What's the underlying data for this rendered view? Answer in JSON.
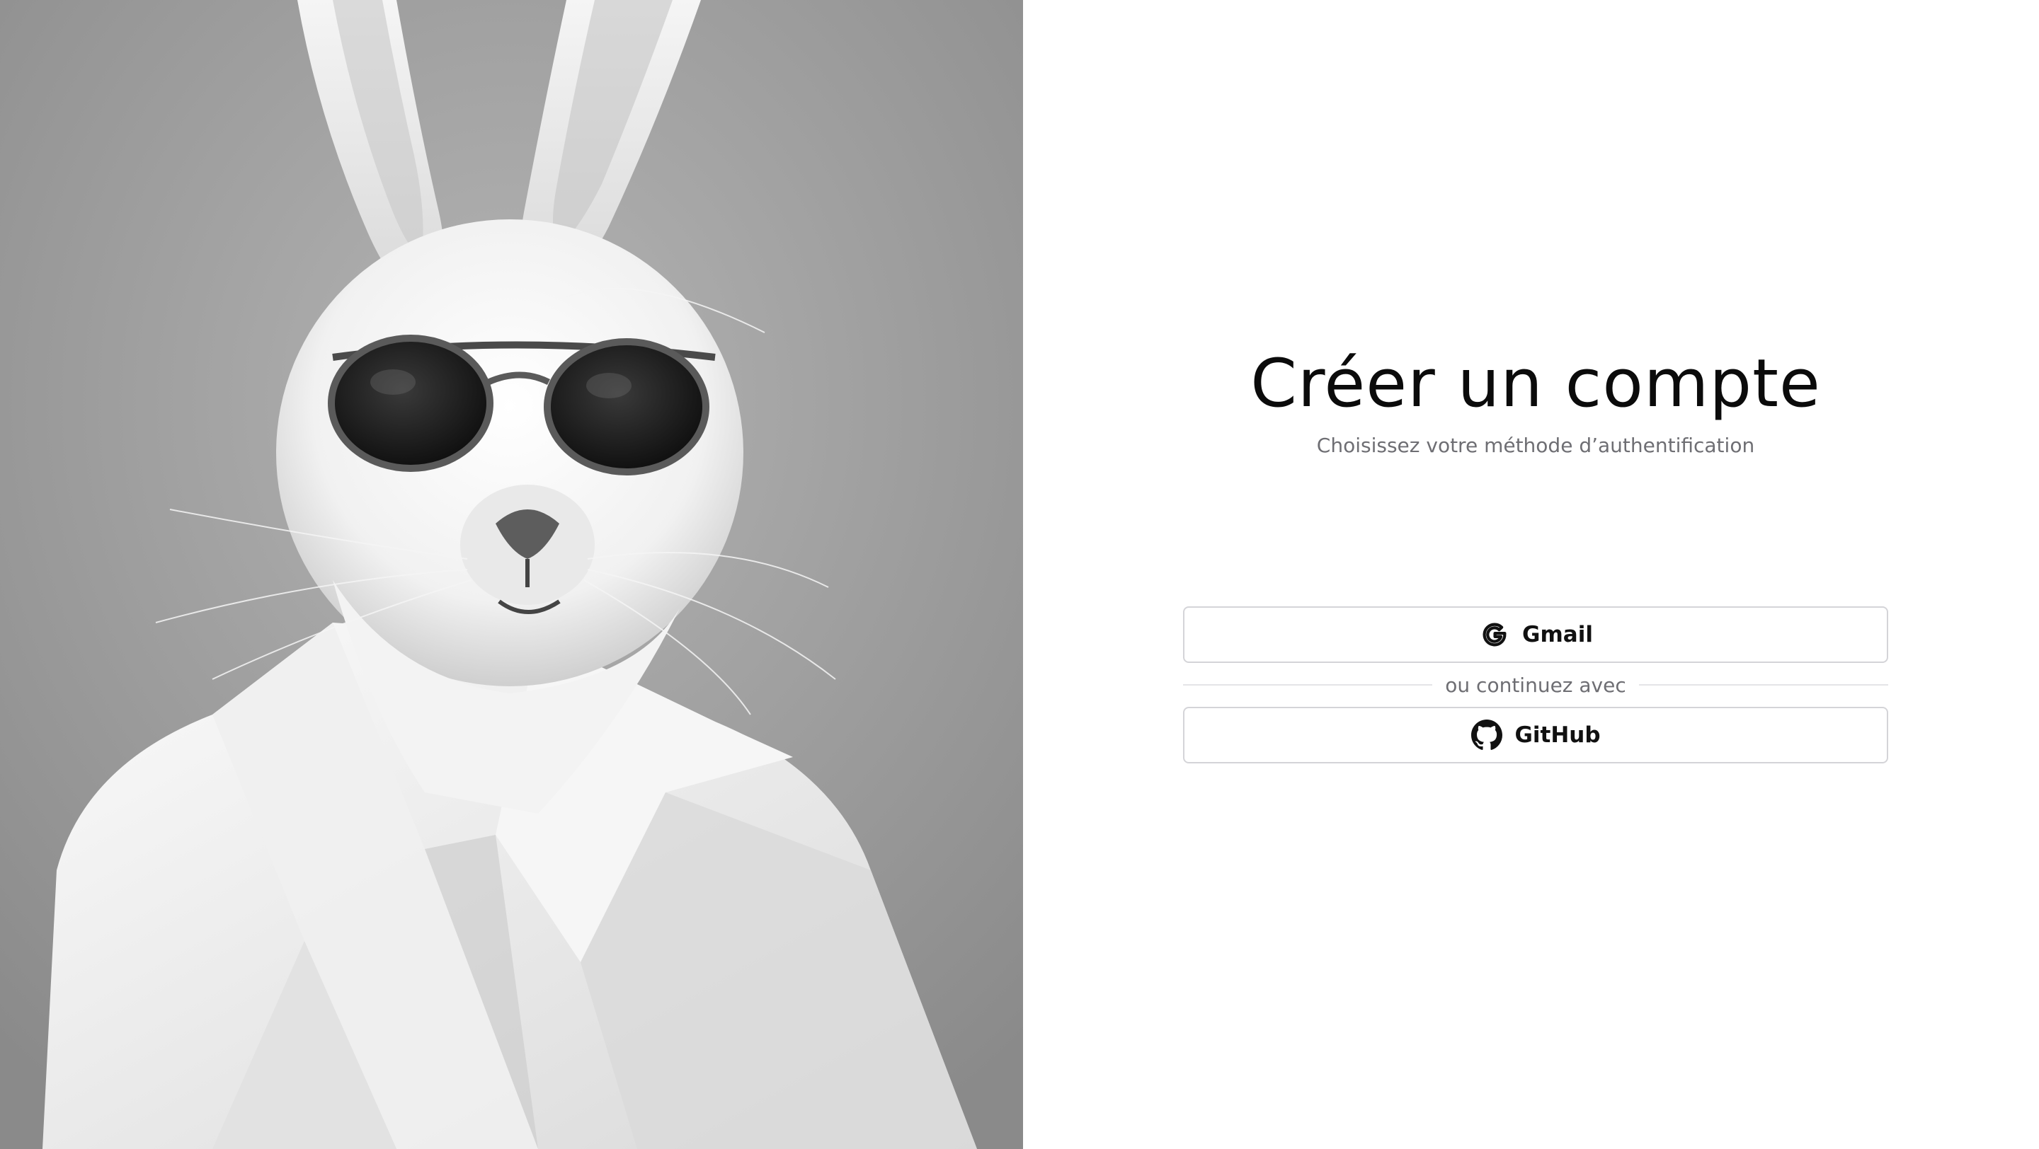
{
  "auth": {
    "title": "Créer un compte",
    "subtitle": "Choisissez votre méthode d’authentification",
    "gmail_button": {
      "label": "Gmail",
      "icon": "google-icon"
    },
    "divider_text": "ou continuez avec",
    "github_button": {
      "label": "GitHub",
      "icon": "github-icon"
    }
  },
  "hero": {
    "image": "rabbit-with-sunglasses-photo"
  },
  "colors": {
    "background": "#ffffff",
    "title": "#0b0b0b",
    "muted_text": "#6e6e73",
    "border": "#d4d4d8",
    "divider": "#e4e4e7"
  }
}
